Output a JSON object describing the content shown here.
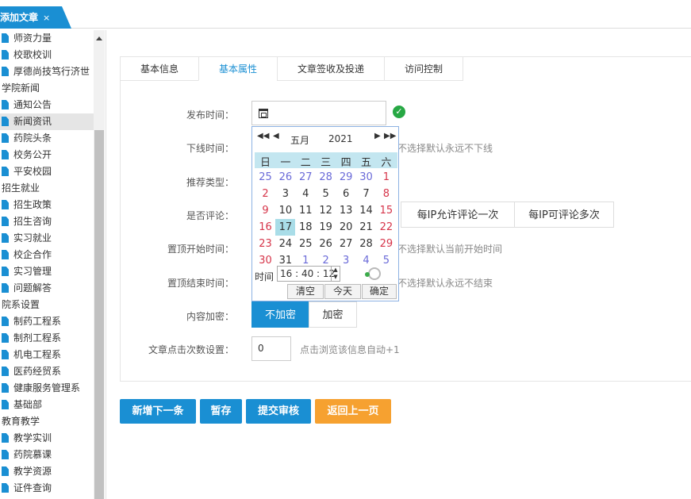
{
  "app_tab": {
    "label": "添加文章",
    "close": "×"
  },
  "sidebar": {
    "items": [
      {
        "type": "leaf",
        "label": "师资力量"
      },
      {
        "type": "leaf",
        "label": "校歌校训"
      },
      {
        "type": "leaf",
        "label": "厚德尚技笃行济世"
      },
      {
        "type": "group",
        "label": "学院新闻"
      },
      {
        "type": "leaf",
        "label": "通知公告"
      },
      {
        "type": "leaf",
        "label": "新闻资讯",
        "active": true
      },
      {
        "type": "leaf",
        "label": "药院头条"
      },
      {
        "type": "leaf",
        "label": "校务公开"
      },
      {
        "type": "leaf",
        "label": "平安校园"
      },
      {
        "type": "group",
        "label": "招生就业"
      },
      {
        "type": "leaf",
        "label": "招生政策"
      },
      {
        "type": "leaf",
        "label": "招生咨询"
      },
      {
        "type": "leaf",
        "label": "实习就业"
      },
      {
        "type": "leaf",
        "label": "校企合作"
      },
      {
        "type": "leaf",
        "label": "实习管理"
      },
      {
        "type": "leaf",
        "label": "问题解答"
      },
      {
        "type": "group",
        "label": "院系设置"
      },
      {
        "type": "leaf",
        "label": "制药工程系"
      },
      {
        "type": "leaf",
        "label": "制剂工程系"
      },
      {
        "type": "leaf",
        "label": "机电工程系"
      },
      {
        "type": "leaf",
        "label": "医药经贸系"
      },
      {
        "type": "leaf",
        "label": "健康服务管理系"
      },
      {
        "type": "leaf",
        "label": "基础部"
      },
      {
        "type": "group",
        "label": "教育教学"
      },
      {
        "type": "leaf",
        "label": "教学实训"
      },
      {
        "type": "leaf",
        "label": "药院慕课"
      },
      {
        "type": "leaf",
        "label": "教学资源"
      },
      {
        "type": "leaf",
        "label": "证件查询"
      }
    ]
  },
  "tabs": [
    "基本信息",
    "基本属性",
    "文章签收及投递",
    "访问控制"
  ],
  "active_tab": "基本属性",
  "form": {
    "publish_time_label": "发布时间：",
    "offline_time_label": "下线时间：",
    "offline_hint": "不选择默认永远不下线",
    "recommend_label": "推荐类型：",
    "comment_label": "是否评论：",
    "comment_options": [
      "每IP允许评论一次",
      "每IP可评论多次"
    ],
    "top_start_label": "置顶开始时间：",
    "top_start_hint": "不选择默认当前开始时间",
    "top_end_label": "置顶结束时间：",
    "top_end_hint": "不选择默认永远不结束",
    "encrypt_label": "内容加密：",
    "encrypt_options": [
      "不加密",
      "加密"
    ],
    "encrypt_selected": "不加密",
    "clicks_label": "文章点击次数设置：",
    "clicks_value": "0",
    "clicks_hint": "点击浏览该信息自动+1"
  },
  "calendar": {
    "month": "五月",
    "year": "2021",
    "weekdays": [
      "日",
      "一",
      "二",
      "三",
      "四",
      "五",
      "六"
    ],
    "weeks": [
      [
        "25",
        "26",
        "27",
        "28",
        "29",
        "30",
        "1"
      ],
      [
        "2",
        "3",
        "4",
        "5",
        "6",
        "7",
        "8"
      ],
      [
        "9",
        "10",
        "11",
        "12",
        "13",
        "14",
        "15"
      ],
      [
        "16",
        "17",
        "18",
        "19",
        "20",
        "21",
        "22"
      ],
      [
        "23",
        "24",
        "25",
        "26",
        "27",
        "28",
        "29"
      ],
      [
        "30",
        "31",
        "1",
        "2",
        "3",
        "4",
        "5"
      ]
    ],
    "today": "17",
    "time_label": "时间",
    "time_value": "16 : 40 : 12",
    "clear_label": "清空",
    "today_label": "今天",
    "ok_label": "确定"
  },
  "buttons": {
    "new_next": "新增下一条",
    "save_draft": "暂存",
    "submit_review": "提交审核",
    "go_back": "返回上一页"
  },
  "colors": {
    "accent": "#1a8fd3",
    "orange": "#f6a130",
    "success": "#27a844",
    "weekend": "#d6354a",
    "other_month": "#6a6ad8"
  }
}
